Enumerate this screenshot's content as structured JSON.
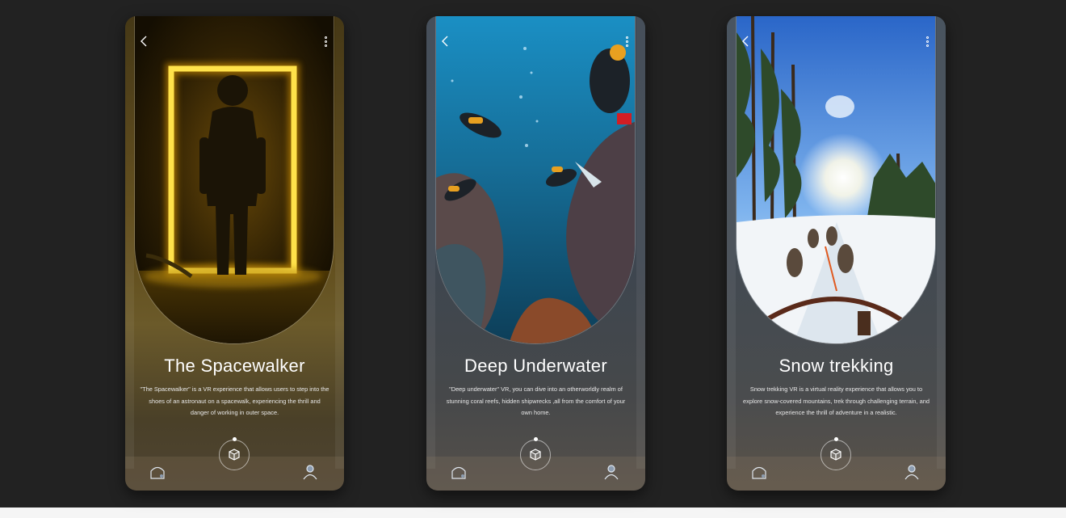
{
  "cards": [
    {
      "title": "The Spacewalker",
      "description": "\"The Spacewalker\" is a VR experience that allows users to step into the shoes of an astronaut on a spacewalk, experiencing the thrill and danger of working in outer space.",
      "image": "astronaut-in-yellow-neon-frame"
    },
    {
      "title": "Deep Underwater",
      "description": "\"Deep underwater\" VR, you can dive into an otherworldly realm of stunning coral reefs, hidden shipwrecks ,all from the comfort of your own home.",
      "image": "scuba-divers-over-coral-reef"
    },
    {
      "title": "Snow trekking",
      "description": "Snow trekking VR is a virtual reality experience that allows you to explore snow-covered mountains, trek through challenging terrain, and experience the thrill of adventure in a realistic.",
      "image": "dog-sled-on-snowy-forest-trail"
    }
  ],
  "icons": {
    "back": "chevron-left-icon",
    "more": "more-vertical-icon",
    "home": "home-icon",
    "vr": "cube-icon",
    "profile": "user-icon"
  },
  "colors": {
    "page_bg": "#222222",
    "text": "#ffffff",
    "neon": "#ffd400"
  }
}
